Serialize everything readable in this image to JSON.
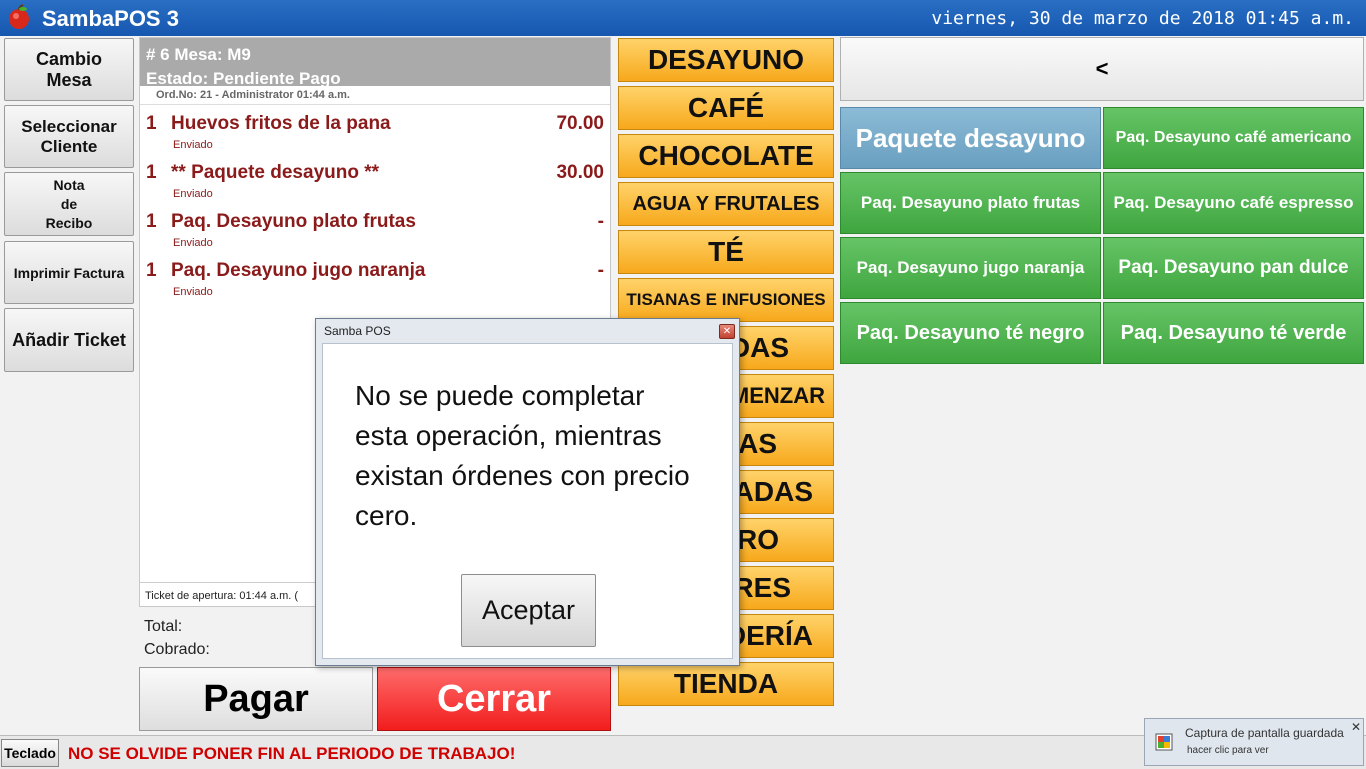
{
  "header": {
    "app_title": "SambaPOS 3",
    "datetime": "viernes, 30 de marzo de 2018 01:45 a.m.",
    "logo_icon": "apple-icon"
  },
  "left_buttons": [
    {
      "label": "Cambio\nMesa"
    },
    {
      "label": "Seleccionar\nCliente"
    },
    {
      "label": "Nota\nde\nRecibo"
    },
    {
      "label": "Imprimir Factura"
    },
    {
      "label": "Añadir Ticket"
    }
  ],
  "ticket": {
    "header_line1": "# 6 Mesa: M9",
    "header_line2": "Estado: Pendiente Pago",
    "order_meta": "Ord.No: 21 - Administrator 01:44 a.m.",
    "lines": [
      {
        "qty": "1",
        "name": "Huevos fritos de la pana",
        "price": "70.00",
        "status": "Enviado"
      },
      {
        "qty": "1",
        "name": "** Paquete desayuno **",
        "price": "30.00",
        "status": "Enviado"
      },
      {
        "qty": "1",
        "name": "Paq. Desayuno  plato frutas",
        "price": "-",
        "status": "Enviado"
      },
      {
        "qty": "1",
        "name": "Paq. Desayuno jugo naranja",
        "price": "-",
        "status": "Enviado"
      }
    ],
    "footer": "Ticket de apertura:    01:44 a.m. (",
    "total_label": "Total:",
    "paid_label": "Cobrado:"
  },
  "actions": {
    "pay": "Pagar",
    "close": "Cerrar"
  },
  "categories": [
    {
      "label": "DESAYUNO"
    },
    {
      "label": "CAFÉ"
    },
    {
      "label": "CHOCOLATE"
    },
    {
      "label": "AGUA Y FRUTALES"
    },
    {
      "label": "TÉ"
    },
    {
      "label": "TISANAS E INFUSIONES"
    },
    {
      "label": "DAS"
    },
    {
      "label": "MENZAR"
    },
    {
      "label": "AS"
    },
    {
      "label": "ADAS"
    },
    {
      "label": "RO"
    },
    {
      "label": "RES"
    },
    {
      "label": "DERÍA"
    },
    {
      "label": "TIENDA"
    }
  ],
  "products": {
    "back_label": "<",
    "items": [
      {
        "label": "Paquete desayuno",
        "color": "#7aaecc"
      },
      {
        "label": "Paq. Desayuno café americano",
        "color": "#4cae4c"
      },
      {
        "label": "Paq. Desayuno  plato frutas",
        "color": "#4cae4c"
      },
      {
        "label": "Paq. Desayuno café espresso",
        "color": "#4cae4c"
      },
      {
        "label": "Paq. Desayuno jugo naranja",
        "color": "#4cae4c"
      },
      {
        "label": "Paq. Desayuno pan dulce",
        "color": "#4cae4c"
      },
      {
        "label": "Paq. Desayuno té negro",
        "color": "#4cae4c"
      },
      {
        "label": "Paq. Desayuno té verde",
        "color": "#4cae4c"
      }
    ]
  },
  "status_bar": {
    "keyboard_label": "Teclado",
    "warning": "NO SE OLVIDE PONER FIN AL PERIODO DE TRABAJO!"
  },
  "toast": {
    "title": "Captura de pantalla guardada",
    "subtitle": "hacer clic para ver",
    "close": "✕"
  },
  "dialog": {
    "title": "Samba POS",
    "message": "No se puede completar esta operación, mientras existan órdenes con precio cero.",
    "ok_label": "Aceptar",
    "close_glyph": "✕"
  },
  "colors": {
    "header_blue": "#1f63ba",
    "category_orange": "#f9b938",
    "product_green": "#4cae4c",
    "close_red": "#f03030",
    "warning_red": "#d00000"
  }
}
